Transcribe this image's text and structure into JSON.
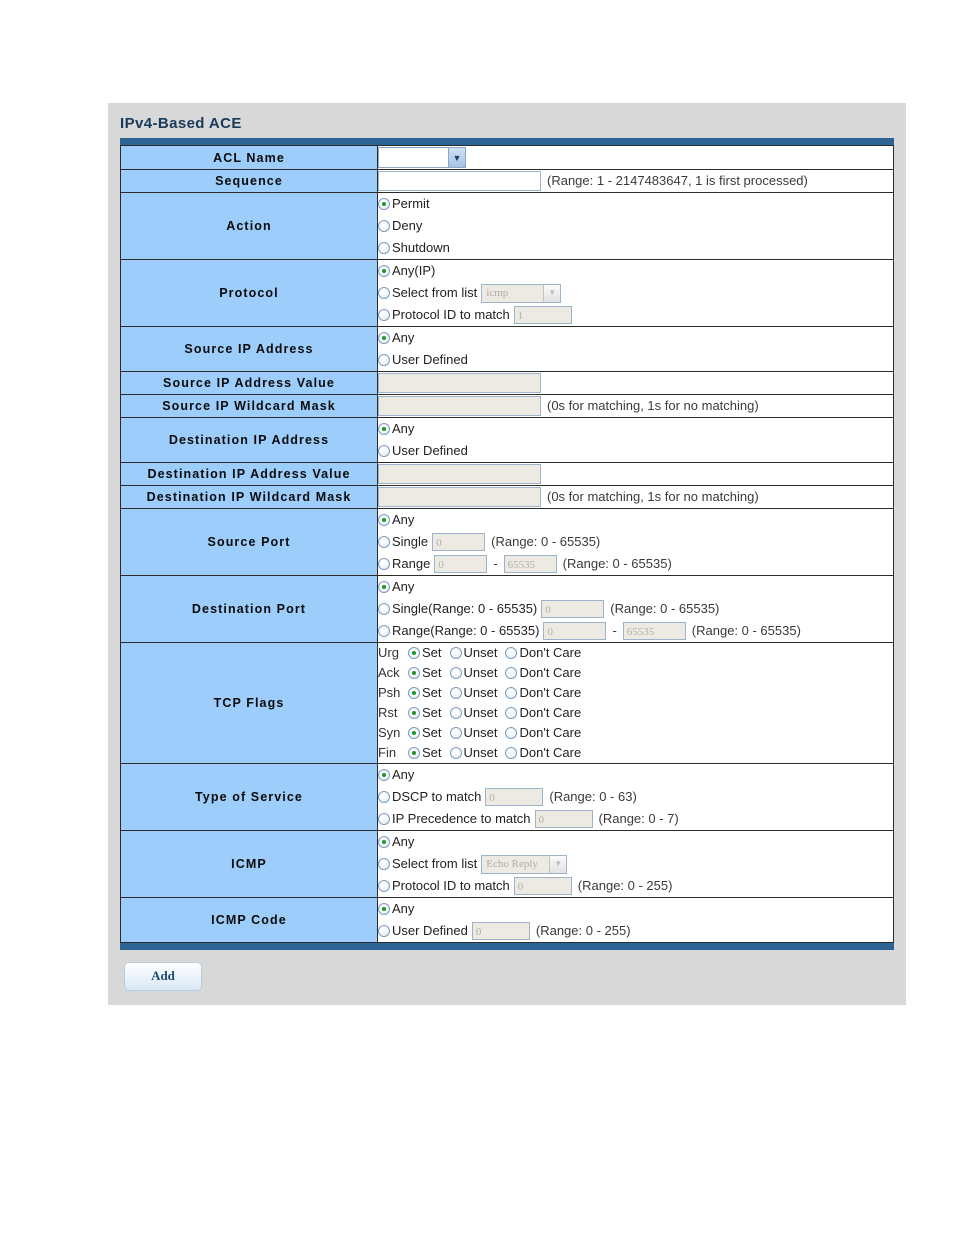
{
  "panel": {
    "title": "IPv4-Based ACE"
  },
  "rows": {
    "acl_name": {
      "label": "ACL Name",
      "select_value": ""
    },
    "sequence": {
      "label": "Sequence",
      "value": "",
      "hint": "(Range: 1 - 2147483647, 1 is first processed)"
    },
    "action": {
      "label": "Action",
      "options": [
        "Permit",
        "Deny",
        "Shutdown"
      ],
      "selected": "Permit"
    },
    "protocol": {
      "label": "Protocol",
      "opt_any": "Any(IP)",
      "opt_list": "Select from list",
      "list_value": "icmp",
      "opt_id": "Protocol ID to match",
      "id_value": "1",
      "selected": "Any(IP)"
    },
    "source_ip": {
      "label": "Source IP Address",
      "opt_any": "Any",
      "opt_user": "User Defined",
      "selected": "Any"
    },
    "source_ip_value": {
      "label": "Source IP Address Value",
      "value": ""
    },
    "source_ip_mask": {
      "label": "Source IP Wildcard Mask",
      "value": "",
      "hint": "(0s for matching, 1s for no matching)"
    },
    "dest_ip": {
      "label": "Destination IP Address",
      "opt_any": "Any",
      "opt_user": "User Defined",
      "selected": "Any"
    },
    "dest_ip_value": {
      "label": "Destination IP Address Value",
      "value": ""
    },
    "dest_ip_mask": {
      "label": "Destination IP Wildcard Mask",
      "value": "",
      "hint": "(0s for matching, 1s for no matching)"
    },
    "source_port": {
      "label": "Source Port",
      "opt_any": "Any",
      "opt_single": "Single",
      "single_value": "0",
      "single_hint": "(Range: 0 - 65535)",
      "opt_range": "Range",
      "range_from": "0",
      "range_dash": "-",
      "range_to": "65535",
      "range_hint": "(Range: 0 - 65535)",
      "selected": "Any"
    },
    "dest_port": {
      "label": "Destination Port",
      "opt_any": "Any",
      "opt_single": "Single(Range: 0 - 65535)",
      "single_value": "0",
      "single_hint": "(Range: 0 - 65535)",
      "opt_range": "Range(Range: 0 - 65535)",
      "range_from": "0",
      "range_dash": "-",
      "range_to": "65535",
      "range_hint": "(Range: 0 - 65535)",
      "selected": "Any"
    },
    "tcp_flags": {
      "label": "TCP Flags",
      "opt_set": "Set",
      "opt_unset": "Unset",
      "opt_dont_care": "Don't Care",
      "flags": [
        {
          "name": "Urg",
          "selected": "Set"
        },
        {
          "name": "Ack",
          "selected": "Set"
        },
        {
          "name": "Psh",
          "selected": "Set"
        },
        {
          "name": "Rst",
          "selected": "Set"
        },
        {
          "name": "Syn",
          "selected": "Set"
        },
        {
          "name": "Fin",
          "selected": "Set"
        }
      ]
    },
    "tos": {
      "label": "Type of Service",
      "opt_any": "Any",
      "opt_dscp": "DSCP to match",
      "dscp_value": "0",
      "dscp_hint": "(Range: 0 - 63)",
      "opt_prec": "IP Precedence to match",
      "prec_value": "0",
      "prec_hint": "(Range: 0 - 7)",
      "selected": "Any"
    },
    "icmp": {
      "label": "ICMP",
      "opt_any": "Any",
      "opt_list": "Select from list",
      "list_value": "Echo Reply",
      "opt_id": "Protocol ID to match",
      "id_value": "0",
      "id_hint": "(Range: 0 - 255)",
      "selected": "Any"
    },
    "icmp_code": {
      "label": "ICMP Code",
      "opt_any": "Any",
      "opt_user": "User Defined",
      "user_value": "0",
      "user_hint": "(Range: 0 - 255)",
      "selected": "Any"
    }
  },
  "footer": {
    "add_label": "Add"
  },
  "colors": {
    "header_band": "#2d6395",
    "label_cell": "#9ccdfb",
    "panel_bg": "#d8d8d8",
    "radio_dot": "#1a9a22",
    "title_text": "#1a3a5c"
  }
}
